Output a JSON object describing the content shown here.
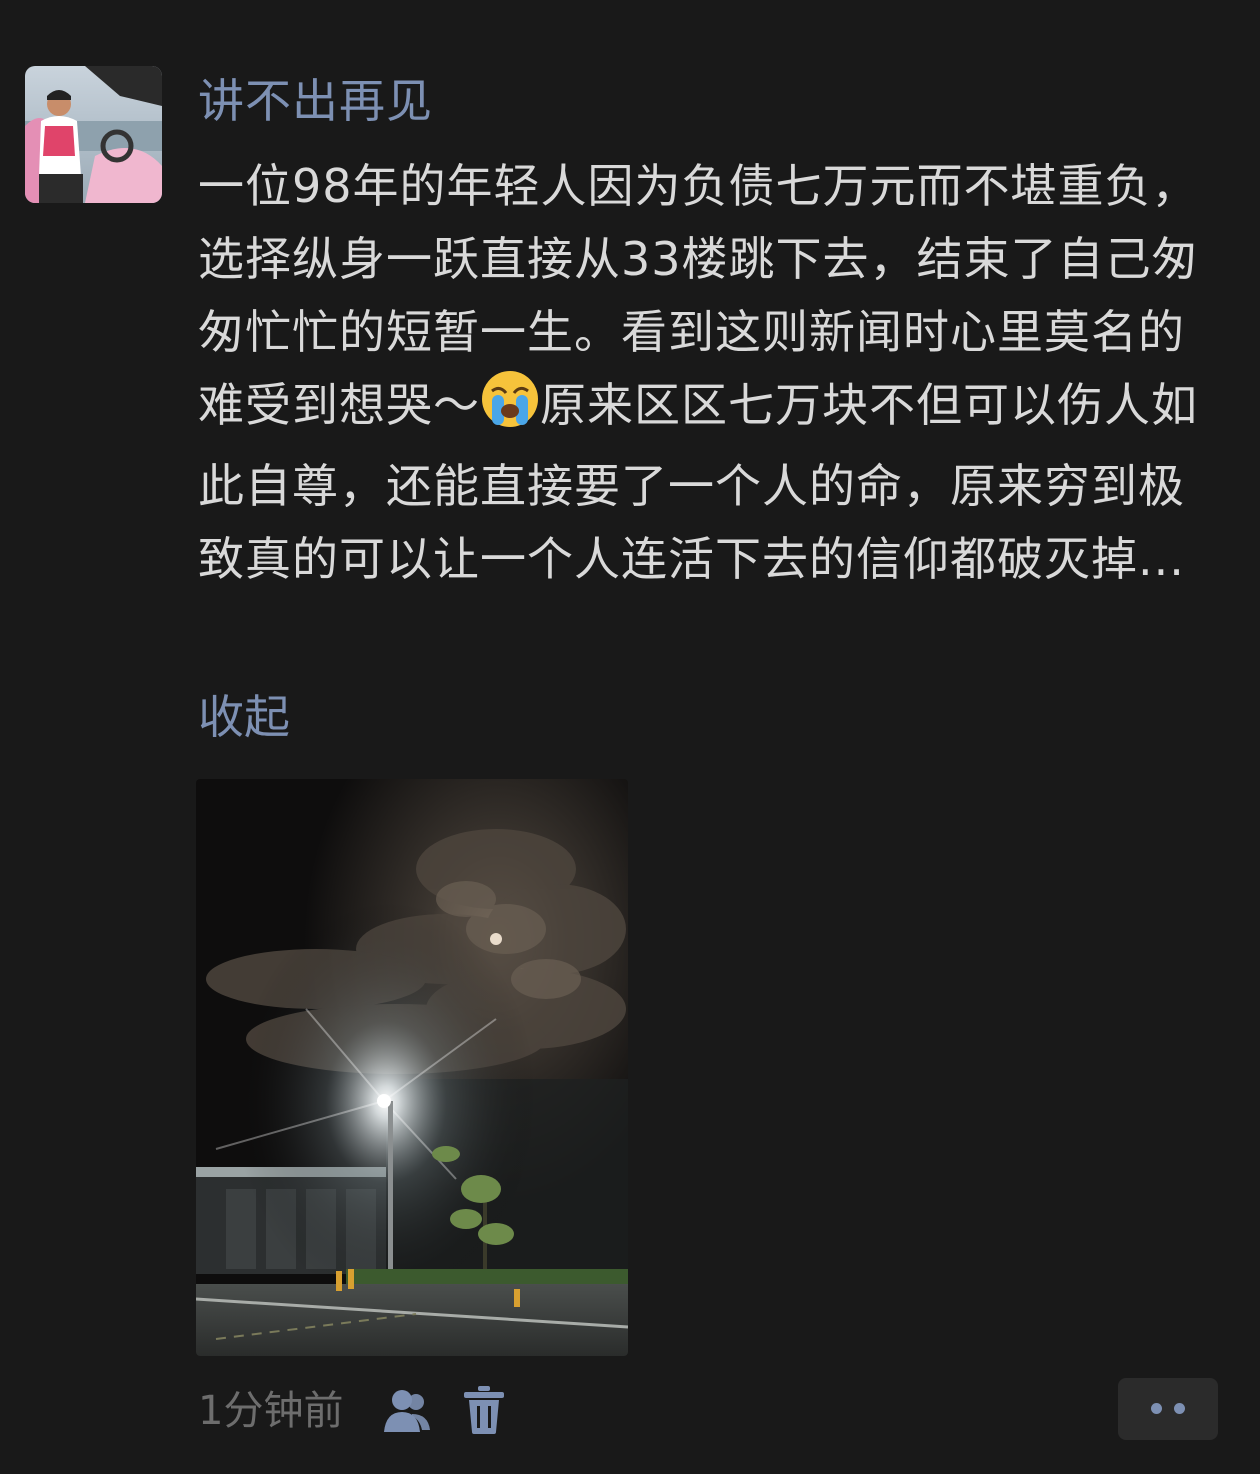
{
  "post": {
    "author": "讲不出再见",
    "text_before_emoji": "一位98年的年轻人因为负债七万元而不堪重负，选择纵身一跃直接从33楼跳下去，结束了自己匆匆忙忙的短暂一生。看到这则新闻时心里莫名的难受到想哭～",
    "emoji": "crying-face-emoji",
    "text_after_emoji": "原来区区七万块不但可以伤人如此自尊，还能直接要了一个人的命，原来穷到极致真的可以让一个人连活下去的信仰都破灭掉...",
    "collapse_label": "收起",
    "image": {
      "description_icon": "night-street-lamp-photo"
    },
    "time": "1分钟前"
  },
  "icons": {
    "friends": "friends-visibility-icon",
    "delete": "trash-icon",
    "more": "more-dots-icon"
  },
  "colors": {
    "background": "#191919",
    "link": "#7d90b3",
    "text": "#d9d9d9",
    "muted": "#6d6d6d"
  }
}
